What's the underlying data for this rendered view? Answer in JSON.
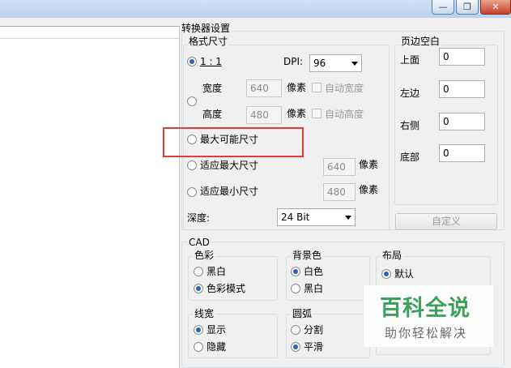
{
  "window": {
    "minimize_icon": "minimize-icon",
    "restore_icon": "restore-icon",
    "close_icon": "close-icon"
  },
  "converter_settings": {
    "title": "转换器设置",
    "format_size": {
      "title": "格式尺寸",
      "one_to_one": "1 : 1",
      "dpi_label": "DPI:",
      "dpi_value": "96",
      "width_label": "宽度",
      "width_value": "640",
      "height_label": "高度",
      "height_value": "480",
      "pixel_unit": "像素",
      "auto_width": "自动宽度",
      "auto_height": "自动高度",
      "max_possible": "最大可能尺寸",
      "fit_max": "适应最大尺寸",
      "fit_max_value": "640",
      "fit_min": "适应最小尺寸",
      "fit_min_value": "480",
      "depth_label": "深度:",
      "depth_value": "24 Bit"
    },
    "margins": {
      "title": "页边空白",
      "top_label": "上面",
      "top_value": "0",
      "left_label": "左边",
      "left_value": "0",
      "right_label": "右侧",
      "right_value": "0",
      "bottom_label": "底部",
      "bottom_value": "0",
      "custom_button": "自定义"
    }
  },
  "cad": {
    "title": "CAD",
    "color": {
      "title": "色彩",
      "bw": "黑白",
      "color_mode": "色彩模式"
    },
    "background": {
      "title": "背景色",
      "white": "白色",
      "black": "黑白"
    },
    "layout": {
      "title": "布局",
      "default": "默认"
    },
    "line_width": {
      "title": "线宽",
      "show": "显示",
      "hide": "隐藏"
    },
    "arc": {
      "title": "圆弧",
      "split": "分割",
      "smooth": "平滑"
    }
  },
  "watermark": {
    "title": "百科全说",
    "subtitle": "助你轻松解决"
  },
  "colors": {
    "highlight": "#e13b3b",
    "radio_dot": "#2b63b6",
    "watermark_green": "#3ea15a"
  }
}
